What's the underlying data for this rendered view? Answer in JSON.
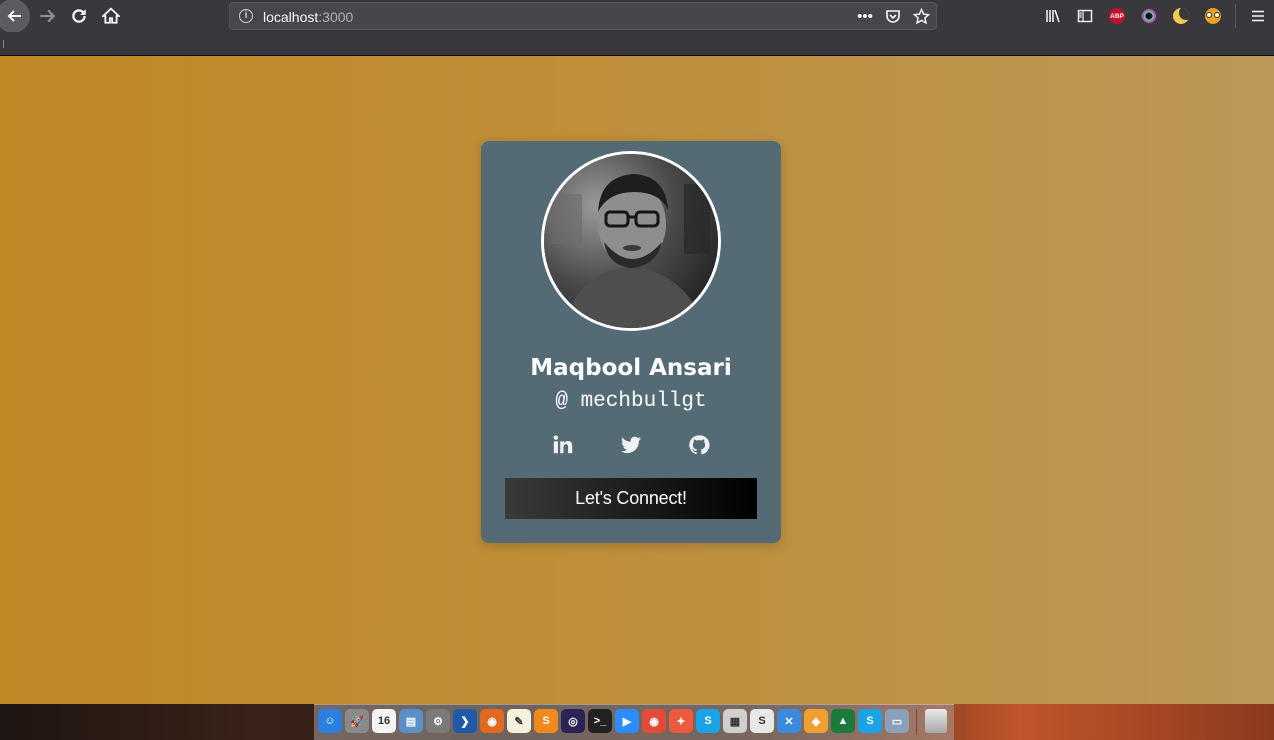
{
  "browser": {
    "url_host": "localhost",
    "url_port": ":3000",
    "extensions": [
      "library-icon",
      "sidebar-icon",
      "adblock-plus-icon",
      "color-picker-icon",
      "dark-mode-icon",
      "owl-extension-icon",
      "menu-icon"
    ],
    "abp_label": "ABP"
  },
  "profile": {
    "name": "Maqbool Ansari",
    "handle": "@ mechbullgt",
    "socials": [
      "linkedin-icon",
      "twitter-icon",
      "github-icon"
    ],
    "button_label": "Let's Connect!"
  },
  "dock": {
    "apps": [
      {
        "name": "finder",
        "color": "#2a7fe0",
        "glyph": "☺"
      },
      {
        "name": "launchpad",
        "color": "#8a8a8a",
        "glyph": "🚀"
      },
      {
        "name": "calendar",
        "color": "#f3f3f3",
        "glyph": "16"
      },
      {
        "name": "preview",
        "color": "#5a8fc8",
        "glyph": "▤"
      },
      {
        "name": "system-preferences",
        "color": "#7a7a7a",
        "glyph": "⚙"
      },
      {
        "name": "vscode",
        "color": "#1e5aa8",
        "glyph": "❯"
      },
      {
        "name": "firefox",
        "color": "#e26a1e",
        "glyph": "◉"
      },
      {
        "name": "notes",
        "color": "#f4f1dc",
        "glyph": "✎"
      },
      {
        "name": "sublime-text",
        "color": "#f08a1c",
        "glyph": "S"
      },
      {
        "name": "eclipse",
        "color": "#2c2255",
        "glyph": "◎"
      },
      {
        "name": "terminal",
        "color": "#222",
        "glyph": ">_"
      },
      {
        "name": "zoom",
        "color": "#2d8cff",
        "glyph": "▶"
      },
      {
        "name": "chrome",
        "color": "#e24a3a",
        "glyph": "◉"
      },
      {
        "name": "safari",
        "color": "#f05a3c",
        "glyph": "✦"
      },
      {
        "name": "skype",
        "color": "#1aa3e6",
        "glyph": "S"
      },
      {
        "name": "textedit",
        "color": "#cfcfcf",
        "glyph": "▦"
      },
      {
        "name": "skype-alt",
        "color": "#e8e8e8",
        "glyph": "S"
      },
      {
        "name": "xcode",
        "color": "#3a8ae0",
        "glyph": "✕"
      },
      {
        "name": "cyberduck",
        "color": "#f0a030",
        "glyph": "◆"
      },
      {
        "name": "sourcetree",
        "color": "#1c7a3c",
        "glyph": "▲"
      },
      {
        "name": "skype-blue",
        "color": "#1aa3e6",
        "glyph": "S"
      },
      {
        "name": "screenshot",
        "color": "#8aa0b8",
        "glyph": "▭"
      }
    ]
  },
  "colors": {
    "card": "#546b76",
    "page_gradient_start": "#c08723",
    "page_gradient_end": "#bb9857",
    "button_gradient_start": "#3a3a3a",
    "button_gradient_end": "#000000"
  }
}
